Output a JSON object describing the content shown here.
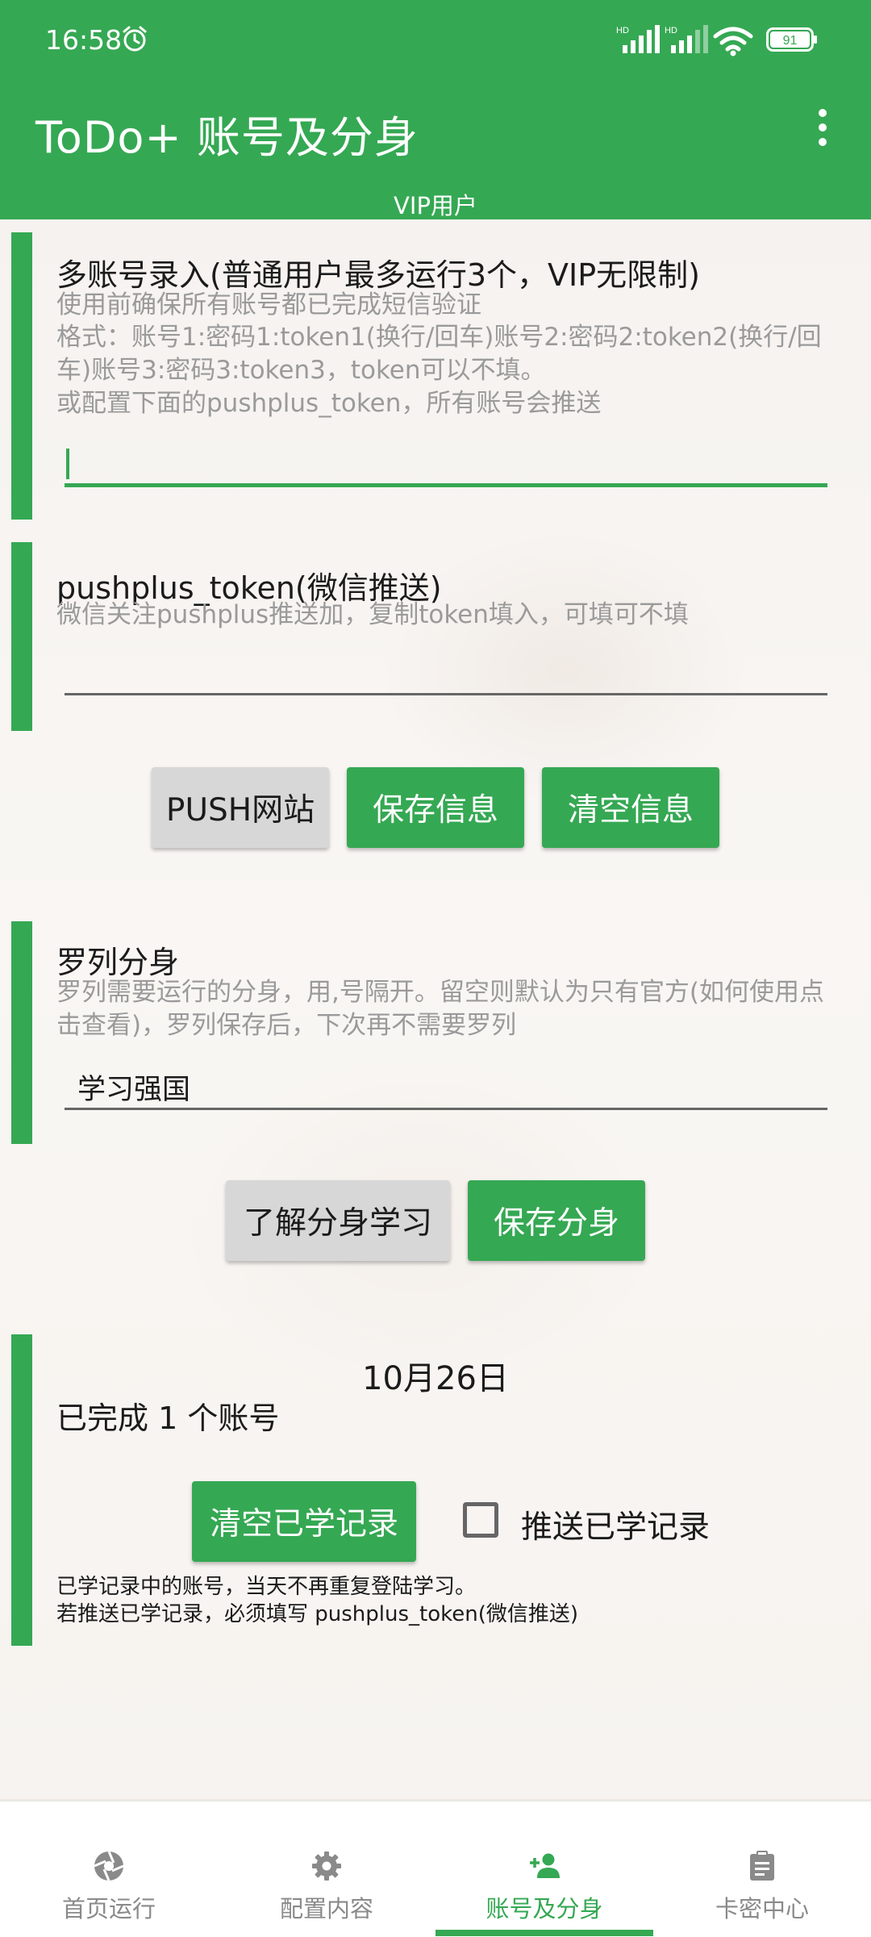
{
  "status_bar": {
    "time": "16:58",
    "battery": "91",
    "network_1": "HD",
    "network_2": "HD"
  },
  "app_bar": {
    "title": "ToDo+ 账号及分身",
    "subtitle": "VIP用户"
  },
  "accounts_card": {
    "title": "多账号录入(普通用户最多运行3个，VIP无限制)",
    "desc_1": "使用前确保所有账号都已完成短信验证",
    "desc_2": "格式：账号1:密码1:token1(换行/回车)账号2:密码2:token2(换行/回车)账号3:密码3:token3，token可以不填。",
    "desc_3": "或配置下面的pushplus_token，所有账号会推送",
    "input_value": ""
  },
  "pushplus_card": {
    "title": "pushplus_token(微信推送)",
    "desc": "微信关注pushplus推送加，复制token填入，可填可不填",
    "input_value": ""
  },
  "actions_1": {
    "push_site": "PUSH网站",
    "save_info": "保存信息",
    "clear_info": "清空信息"
  },
  "clone_card": {
    "title": "罗列分身",
    "desc": "罗列需要运行的分身，用,号隔开。留空则默认为只有官方(如何使用点击查看)，罗列保存后，下次再不需要罗列",
    "input_value": "学习强国"
  },
  "actions_2": {
    "learn_clone": "了解分身学习",
    "save_clone": "保存分身"
  },
  "record_card": {
    "date": "10月26日",
    "done_text": "已完成 1 个账号",
    "clear_records": "清空已学记录",
    "push_records_label": "推送已学记录",
    "push_records_checked": false,
    "note_1": "已学记录中的账号，当天不再重复登陆学习。",
    "note_2": "若推送已学记录，必须填写 pushplus_token(微信推送)"
  },
  "bottom_nav": {
    "items": [
      {
        "label": "首页运行",
        "icon": "aperture-icon",
        "active": false
      },
      {
        "label": "配置内容",
        "icon": "gear-icon",
        "active": false
      },
      {
        "label": "账号及分身",
        "icon": "add-person-icon",
        "active": true
      },
      {
        "label": "卡密中心",
        "icon": "clipboard-icon",
        "active": false
      }
    ]
  },
  "colors": {
    "primary": "#35a853",
    "text": "#1b1b1b",
    "hint": "#9a9a9a"
  }
}
